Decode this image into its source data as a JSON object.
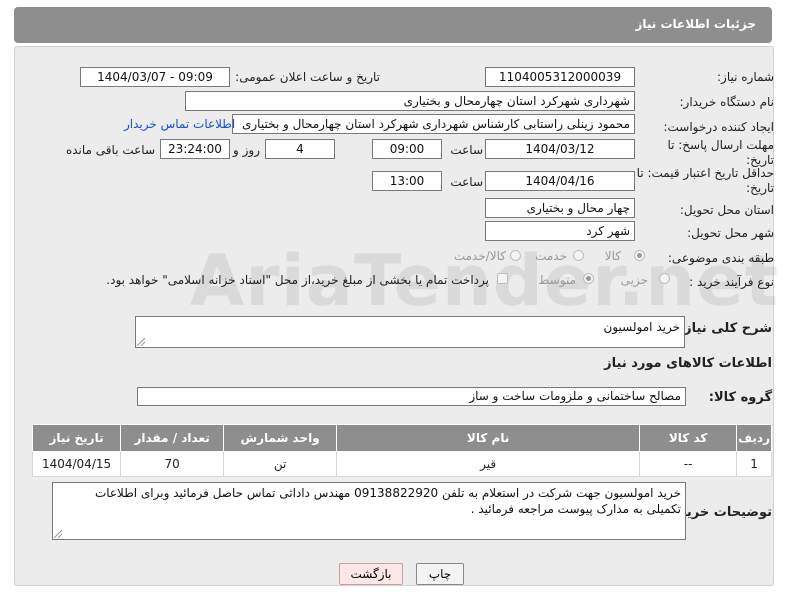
{
  "header": {
    "title": "جزئیات اطلاعات نیاز"
  },
  "form": {
    "need_number_label": "شماره نیاز:",
    "need_number": "1104005312000039",
    "announce_label": "تاریخ و ساعت اعلان عمومی:",
    "announce_value": "1404/03/07 - 09:09",
    "buyer_org_label": "نام دستگاه خریدار:",
    "buyer_org": "شهرداری شهرکرد استان چهارمحال و بختیاری",
    "requester_label": "ایجاد کننده درخواست:",
    "requester": "محمود زینلی راستابی کارشناس شهرداری شهرکرد استان چهارمحال و بختیاری",
    "contact_link": "اطلاعات تماس خریدار",
    "reply_deadline_label": "مهلت ارسال پاسخ: تا تاریخ:",
    "reply_date": "1404/03/12",
    "time_label": "ساعت",
    "reply_time": "09:00",
    "days_value": "4",
    "days_label": "روز و",
    "remaining_time": "23:24:00",
    "remaining_label": "ساعت باقی مانده",
    "price_validity_label": "حداقل تاریخ اعتبار قیمت: تا تاریخ:",
    "validity_date": "1404/04/16",
    "validity_time": "13:00",
    "province_label": "استان محل تحویل:",
    "province": "چهار محال و بختیاری",
    "city_label": "شهر محل تحویل:",
    "city": "شهر کرد",
    "category_label": "طبقه بندی موضوعی:",
    "category_options": [
      "کالا",
      "خدمت",
      "کالا/خدمت"
    ],
    "process_label": "نوع فرآیند خرید :",
    "process_options": [
      "جزیی",
      "متوسط"
    ],
    "payment_note": "پرداخت تمام یا بخشی از مبلغ خرید،از محل \"اسناد خزانه اسلامی\" خواهد بود.",
    "summary_label": "شرح کلی نیاز:",
    "summary": "خرید امولسیون"
  },
  "goods": {
    "section_title": "اطلاعات کالاهای مورد نیاز",
    "group_label": "گروه کالا:",
    "group_value": "مصالح ساختمانی و ملزومات ساخت و ساز",
    "columns": [
      "ردیف",
      "کد کالا",
      "نام کالا",
      "واحد شمارش",
      "تعداد / مقدار",
      "تاریخ نیاز"
    ],
    "rows": [
      [
        "1",
        "--",
        "قیر",
        "تن",
        "70",
        "1404/04/15"
      ]
    ]
  },
  "buyer_notes": {
    "label": "توضیحات خریدار:",
    "text": "خرید امولسیون جهت شرکت در استعلام به تلفن 09138822920 مهندس داداثی تماس حاصل فرمائید وبرای اطلاعات تکمیلی به مدارک پیوست مراجعه فرمائید ."
  },
  "buttons": {
    "print": "چاپ",
    "back": "بازگشت"
  },
  "watermark": "AriaTender.net"
}
